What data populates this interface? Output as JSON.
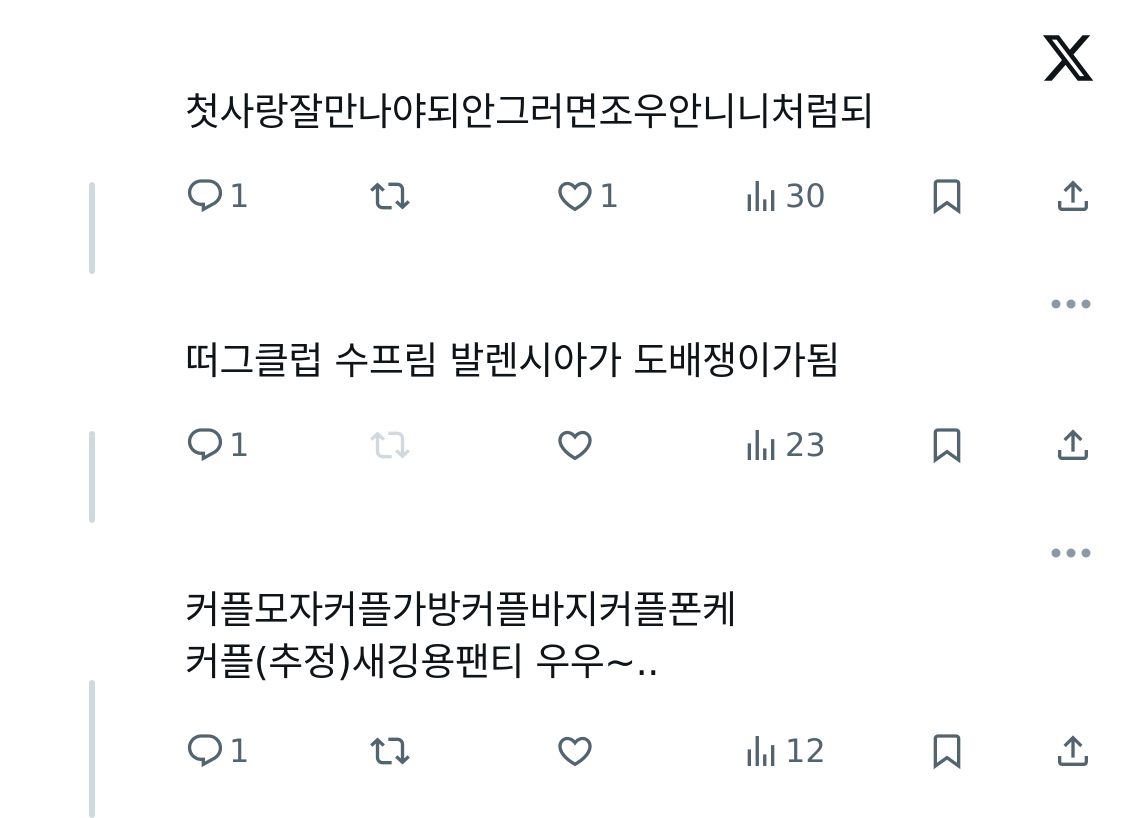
{
  "app": {
    "logo_icon": "x-logo-icon"
  },
  "colors": {
    "icon": "#536471",
    "text": "#0f1419",
    "thread_line": "#cfd9de",
    "disabled_icon": "#cfd9de"
  },
  "posts": [
    {
      "text_lines": [
        "첫사랑잘만나야되안그러면조우안니니처럼되"
      ],
      "replies": "1",
      "reposts": "",
      "likes": "1",
      "views": "30",
      "repost_enabled": true
    },
    {
      "text_lines": [
        "떠그클럽 수프림 발렌시아가 도배쟁이가됨"
      ],
      "replies": "1",
      "reposts": "",
      "likes": "",
      "views": "23",
      "repost_enabled": false
    },
    {
      "text_lines": [
        "커플모자커플가방커플바지커플폰케",
        "커플(추정)새깅용팬티 우우~.."
      ],
      "replies": "1",
      "reposts": "",
      "likes": "",
      "views": "12",
      "repost_enabled": true
    }
  ]
}
